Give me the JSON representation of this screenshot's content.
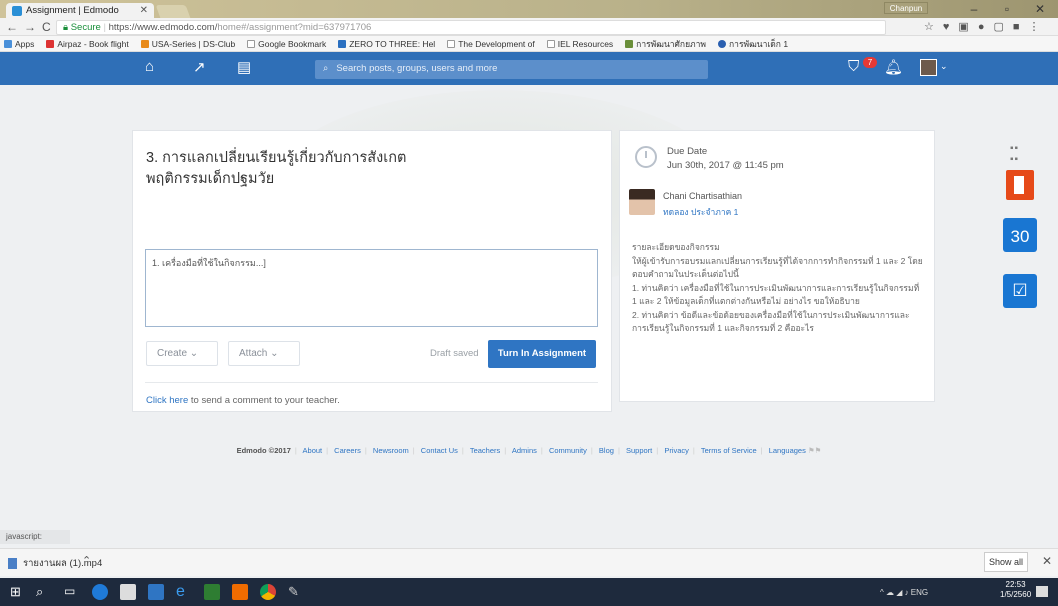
{
  "browser": {
    "tab_title": "Assignment | Edmodo",
    "url_secure": "Secure",
    "url_host": "https://www.edmodo.com/",
    "url_path": "home#/assignment?mid=637971706",
    "user_label": "Chanpun"
  },
  "bookmarks": [
    "Apps",
    "Airpaz - Book flight",
    "USA-Series | DS-Club",
    "Google Bookmark",
    "ZERO TO THREE: Hel",
    "The Development of",
    "IEL Resources",
    "การพัฒนาศักยภาพ",
    "การพัฒนาเด็ก 1"
  ],
  "nav": {
    "search_placeholder": "Search posts, groups, users and more",
    "notification_count": "7"
  },
  "assignment": {
    "title": "3. การแลกเปลี่ยนเรียนรู้เกี่ยวกับการสังเกตพฤติกรรมเด็กปฐมวัย",
    "response_text": "1. เครื่องมือที่ใช้ในกิจกรรม...]",
    "create_label": "Create",
    "attach_label": "Attach",
    "draft_status": "Draft saved",
    "turn_in_label": "Turn In Assignment",
    "comment_link": "Click here",
    "comment_rest": "to send a comment to your teacher."
  },
  "details": {
    "due_label": "Due Date",
    "due_date": "Jun 30th, 2017 @ 11:45 pm",
    "teacher_name": "Chani Chartisathian",
    "teacher_group": "ทดลอง ประจำภาค 1",
    "description": [
      "รายละเอียดของกิจกรรม",
      "ให้ผู้เข้ารับการอบรมแลกเปลี่ยนการเรียนรู้ที่ได้จากการทำกิจกรรมที่ 1 และ 2 โดยตอบคำถามในประเด็นต่อไปนี้",
      "1. ท่านคิดว่า เครื่องมือที่ใช้ในการประเมินพัฒนาการและการเรียนรู้ในกิจกรรมที่ 1 และ 2 ให้ข้อมูลเด็กที่แตกต่างกันหรือไม่ อย่างไร ขอให้อธิบาย",
      "2. ท่านคิดว่า ข้อดีและข้อด้อยของเครื่องมือที่ใช้ในการประเมินพัฒนาการและการเรียนรู้ในกิจกรรมที่ 1 และกิจกรรมที่ 2 คืออะไร"
    ]
  },
  "rail": {
    "calendar_day": "30"
  },
  "footer": {
    "brand": "Edmodo ©2017",
    "links": [
      "About",
      "Careers",
      "Newsroom",
      "Contact Us",
      "Teachers",
      "Admins",
      "Community",
      "Blog",
      "Support",
      "Privacy",
      "Terms of Service",
      "Languages"
    ]
  },
  "status_text": "javascript:",
  "downloads": {
    "file_name": "รายงานผล (1).mp4",
    "show_all": "Show all"
  },
  "taskbar": {
    "tray_text": "ENG",
    "time": "22:53",
    "date": "1/5/2560"
  }
}
